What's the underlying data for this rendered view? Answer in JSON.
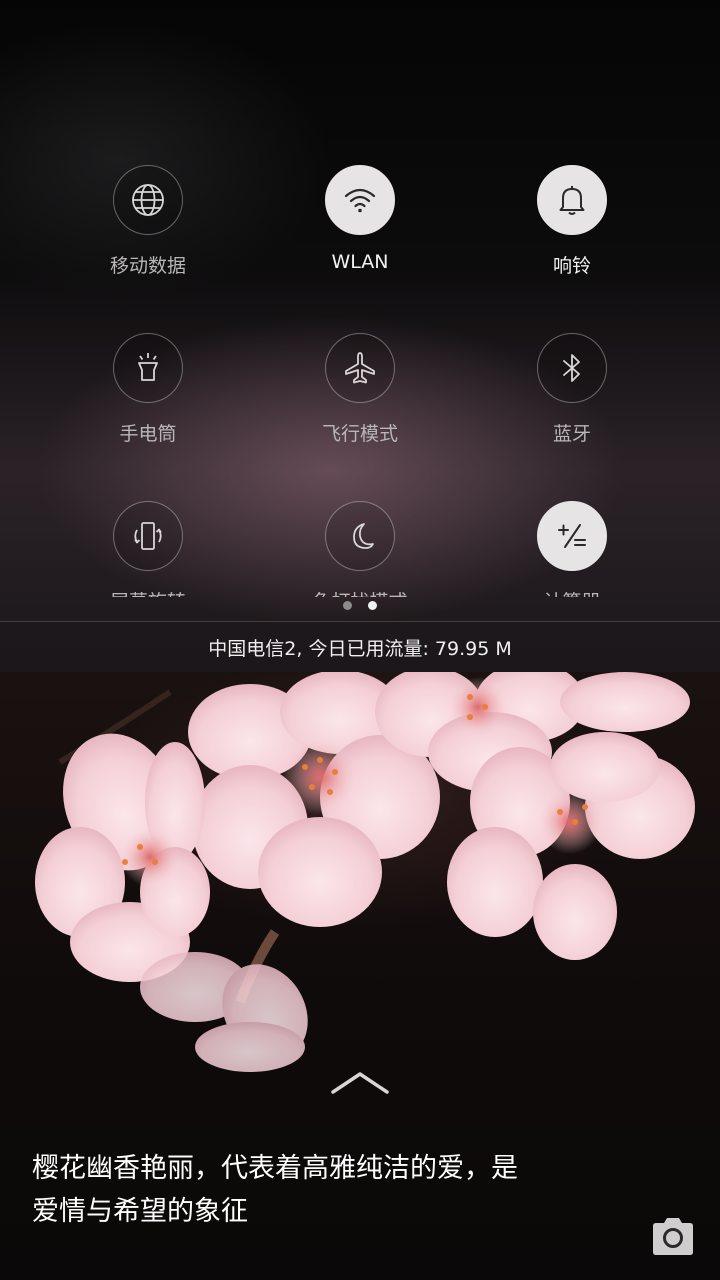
{
  "quick_settings": {
    "tiles": [
      {
        "id": "mobile-data",
        "label": "移动数据",
        "icon": "globe-icon",
        "active": false
      },
      {
        "id": "wlan",
        "label": "WLAN",
        "icon": "wifi-icon",
        "active": true
      },
      {
        "id": "ring",
        "label": "响铃",
        "icon": "bell-icon",
        "active": true
      },
      {
        "id": "flashlight",
        "label": "手电筒",
        "icon": "flashlight-icon",
        "active": false
      },
      {
        "id": "airplane",
        "label": "飞行模式",
        "icon": "airplane-icon",
        "active": false
      },
      {
        "id": "bluetooth",
        "label": "蓝牙",
        "icon": "bluetooth-icon",
        "active": false
      },
      {
        "id": "auto-rotate",
        "label": "屏幕旋转",
        "icon": "rotate-icon",
        "active": false
      },
      {
        "id": "do-not-disturb",
        "label": "免打扰模式",
        "icon": "moon-icon",
        "active": false
      },
      {
        "id": "calculator",
        "label": "计算器",
        "icon": "calculator-icon",
        "active": true
      }
    ],
    "page_indicator": {
      "pages": 2,
      "current": 2
    },
    "data_usage": "中国电信2, 今日已用流量: 79.95 M"
  },
  "lockscreen": {
    "caption_line1": "樱花幽香艳丽，代表着高雅纯洁的爱，是",
    "caption_line2": "爱情与希望的象征",
    "swipe_hint_icon": "chevron-up-icon",
    "camera_icon": "camera-icon"
  },
  "colors": {
    "tile_active_bg": "#e6e4e5",
    "label_dim": "#b8b6b7",
    "blossom_pink": "#f4cfd6"
  }
}
